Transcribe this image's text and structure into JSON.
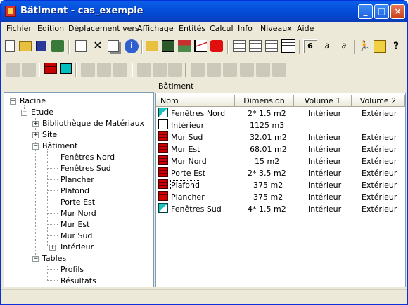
{
  "window": {
    "title": "Bâtiment - cas_exemple"
  },
  "menu": [
    "Fichier",
    "Edition",
    "Déplacement vers",
    "Affichage",
    "Entités",
    "Calcul",
    "Info",
    "Niveaux",
    "Aide"
  ],
  "tree": {
    "root": "Racine",
    "etude": "Etude",
    "bibliotheque": "Bibliothèque de Matériaux",
    "site": "Site",
    "batiment": "Bâtiment",
    "batiment_children": [
      "Fenêtres Nord",
      "Fenêtres Sud",
      "Plancher",
      "Plafond",
      "Porte Est",
      "Mur Nord",
      "Mur Est",
      "Mur Sud"
    ],
    "interieur": "Intérieur",
    "tables": "Tables",
    "tables_children": [
      "Profils",
      "Résultats"
    ]
  },
  "list": {
    "header_title": "Bâtiment",
    "columns": [
      "Nom",
      "Dimension",
      "Volume 1",
      "Volume 2"
    ],
    "rows": [
      {
        "icon": "window-icon",
        "name": "Fenêtres Nord",
        "dimension": "2* 1.5 m2",
        "vol1": "Intérieur",
        "vol2": "Extérieur"
      },
      {
        "icon": "space-icon",
        "name": "Intérieur",
        "dimension": "1125 m3",
        "vol1": "",
        "vol2": ""
      },
      {
        "icon": "wall-icon",
        "name": "Mur Sud",
        "dimension": "32.01 m2",
        "vol1": "Intérieur",
        "vol2": "Extérieur"
      },
      {
        "icon": "wall-icon",
        "name": "Mur Est",
        "dimension": "68.01 m2",
        "vol1": "Intérieur",
        "vol2": "Extérieur"
      },
      {
        "icon": "wall-icon",
        "name": "Mur Nord",
        "dimension": "15 m2",
        "vol1": "Intérieur",
        "vol2": "Extérieur"
      },
      {
        "icon": "wall-icon",
        "name": "Porte Est",
        "dimension": "2* 3.5 m2",
        "vol1": "Intérieur",
        "vol2": "Extérieur"
      },
      {
        "icon": "wall-icon",
        "name": "Plafond",
        "dimension": "375 m2",
        "vol1": "Intérieur",
        "vol2": "Extérieur"
      },
      {
        "icon": "wall-icon",
        "name": "Plancher",
        "dimension": "375 m2",
        "vol1": "Intérieur",
        "vol2": "Extérieur"
      },
      {
        "icon": "window-icon",
        "name": "Fenêtres Sud",
        "dimension": "4* 1.5 m2",
        "vol1": "Intérieur",
        "vol2": "Extérieur"
      }
    ]
  },
  "toolbar_icons": [
    "new-document-icon",
    "open-folder-icon",
    "save-icon",
    "build-icon",
    "new-page-icon",
    "delete-icon",
    "copy-icon",
    "info-icon",
    "up-folder-icon",
    "calculator-icon",
    "house-icon",
    "chart-icon",
    "red-shape-icon",
    "view-large-icon",
    "view-small-icon",
    "view-list-icon",
    "view-details-icon",
    "volume-1-icon",
    "volume-2-icon",
    "volume-3-icon",
    "run-icon",
    "edit-icon",
    "help-icon"
  ],
  "toolbar2_icons": [
    "disabled-1-icon",
    "disabled-2-icon",
    "wall-icon",
    "window-icon",
    "disabled-3-icon",
    "disabled-4-icon",
    "disabled-5-icon",
    "disabled-6-icon",
    "disabled-7-icon",
    "disabled-8-icon",
    "disabled-9-icon",
    "disabled-10-icon",
    "disabled-11-icon",
    "disabled-12-icon",
    "disabled-13-icon"
  ]
}
